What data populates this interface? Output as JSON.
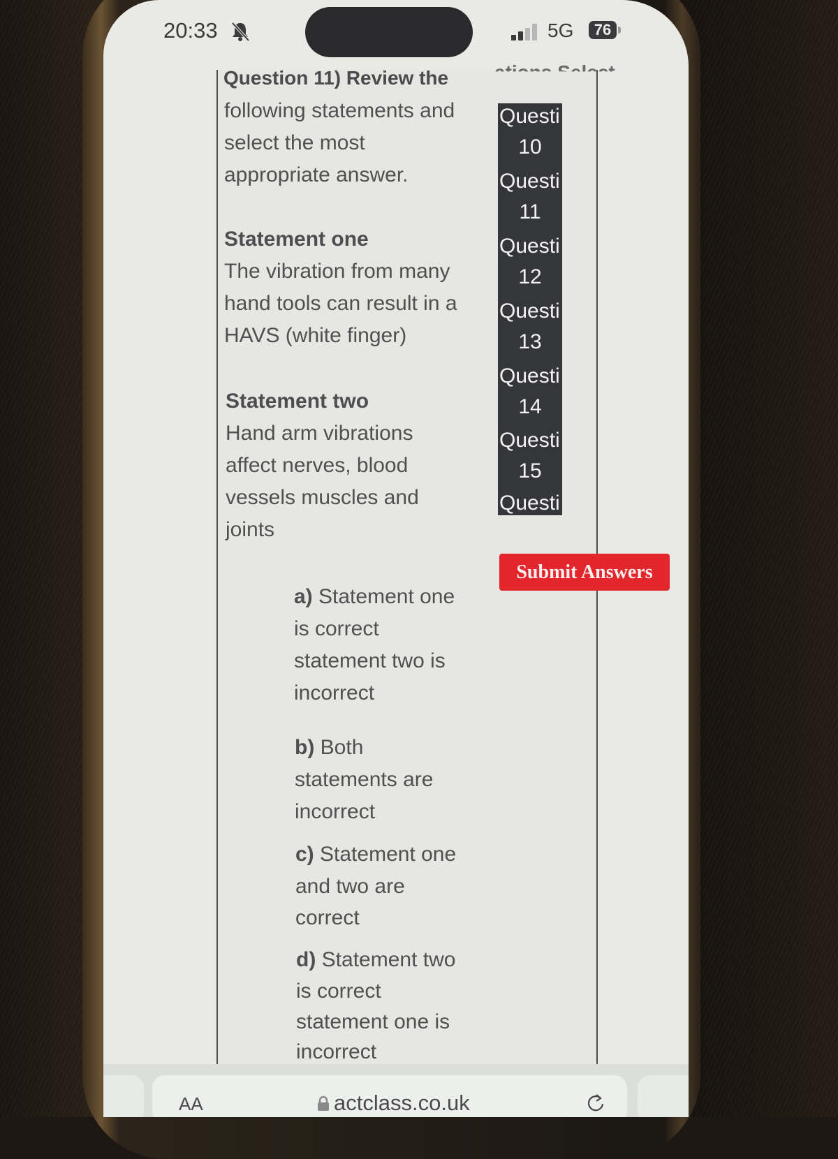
{
  "status_bar": {
    "time": "20:33",
    "mute_icon": "bell-slash-icon",
    "network": "5G",
    "battery": "76",
    "signal_icon": "signal-bars-icon"
  },
  "question": {
    "title": "Question 11) Review the",
    "ghost_overlay": "ations Select",
    "instruction_lines": [
      "following statements and",
      "select the most",
      "appropriate answer."
    ],
    "statement_one": {
      "heading": "Statement one",
      "lines": [
        "The vibration from many",
        "hand tools can result in a",
        "HAVS (white finger)"
      ]
    },
    "statement_two": {
      "heading": "Statement two",
      "lines": [
        "Hand arm vibrations",
        "affect nerves, blood",
        "vessels muscles and",
        "joints"
      ]
    },
    "options": [
      {
        "letter": "a)",
        "lines": [
          "Statement one",
          "is correct",
          "statement two is",
          "incorrect"
        ]
      },
      {
        "letter": "b)",
        "lines": [
          "Both",
          "statements are",
          "incorrect"
        ]
      },
      {
        "letter": "c)",
        "lines": [
          "Statement one",
          "and two are",
          "correct"
        ]
      },
      {
        "letter": "d)",
        "lines": [
          "Statement two",
          "is correct",
          "statement one is",
          "incorrect"
        ]
      }
    ]
  },
  "question_nav": {
    "items": [
      {
        "label": "Questi",
        "number": "10"
      },
      {
        "label": "Questi",
        "number": "11"
      },
      {
        "label": "Questi",
        "number": "12"
      },
      {
        "label": "Questi",
        "number": "13"
      },
      {
        "label": "Questi",
        "number": "14"
      },
      {
        "label": "Questi",
        "number": "15"
      },
      {
        "label": "Questi",
        "number": ""
      }
    ]
  },
  "submit": {
    "label": "Submit Answers",
    "color": "#e3262b"
  },
  "browser": {
    "aa_label": "AA",
    "url": "actclass.co.uk",
    "lock_icon": "lock-icon",
    "reload_icon": "reload-icon"
  }
}
